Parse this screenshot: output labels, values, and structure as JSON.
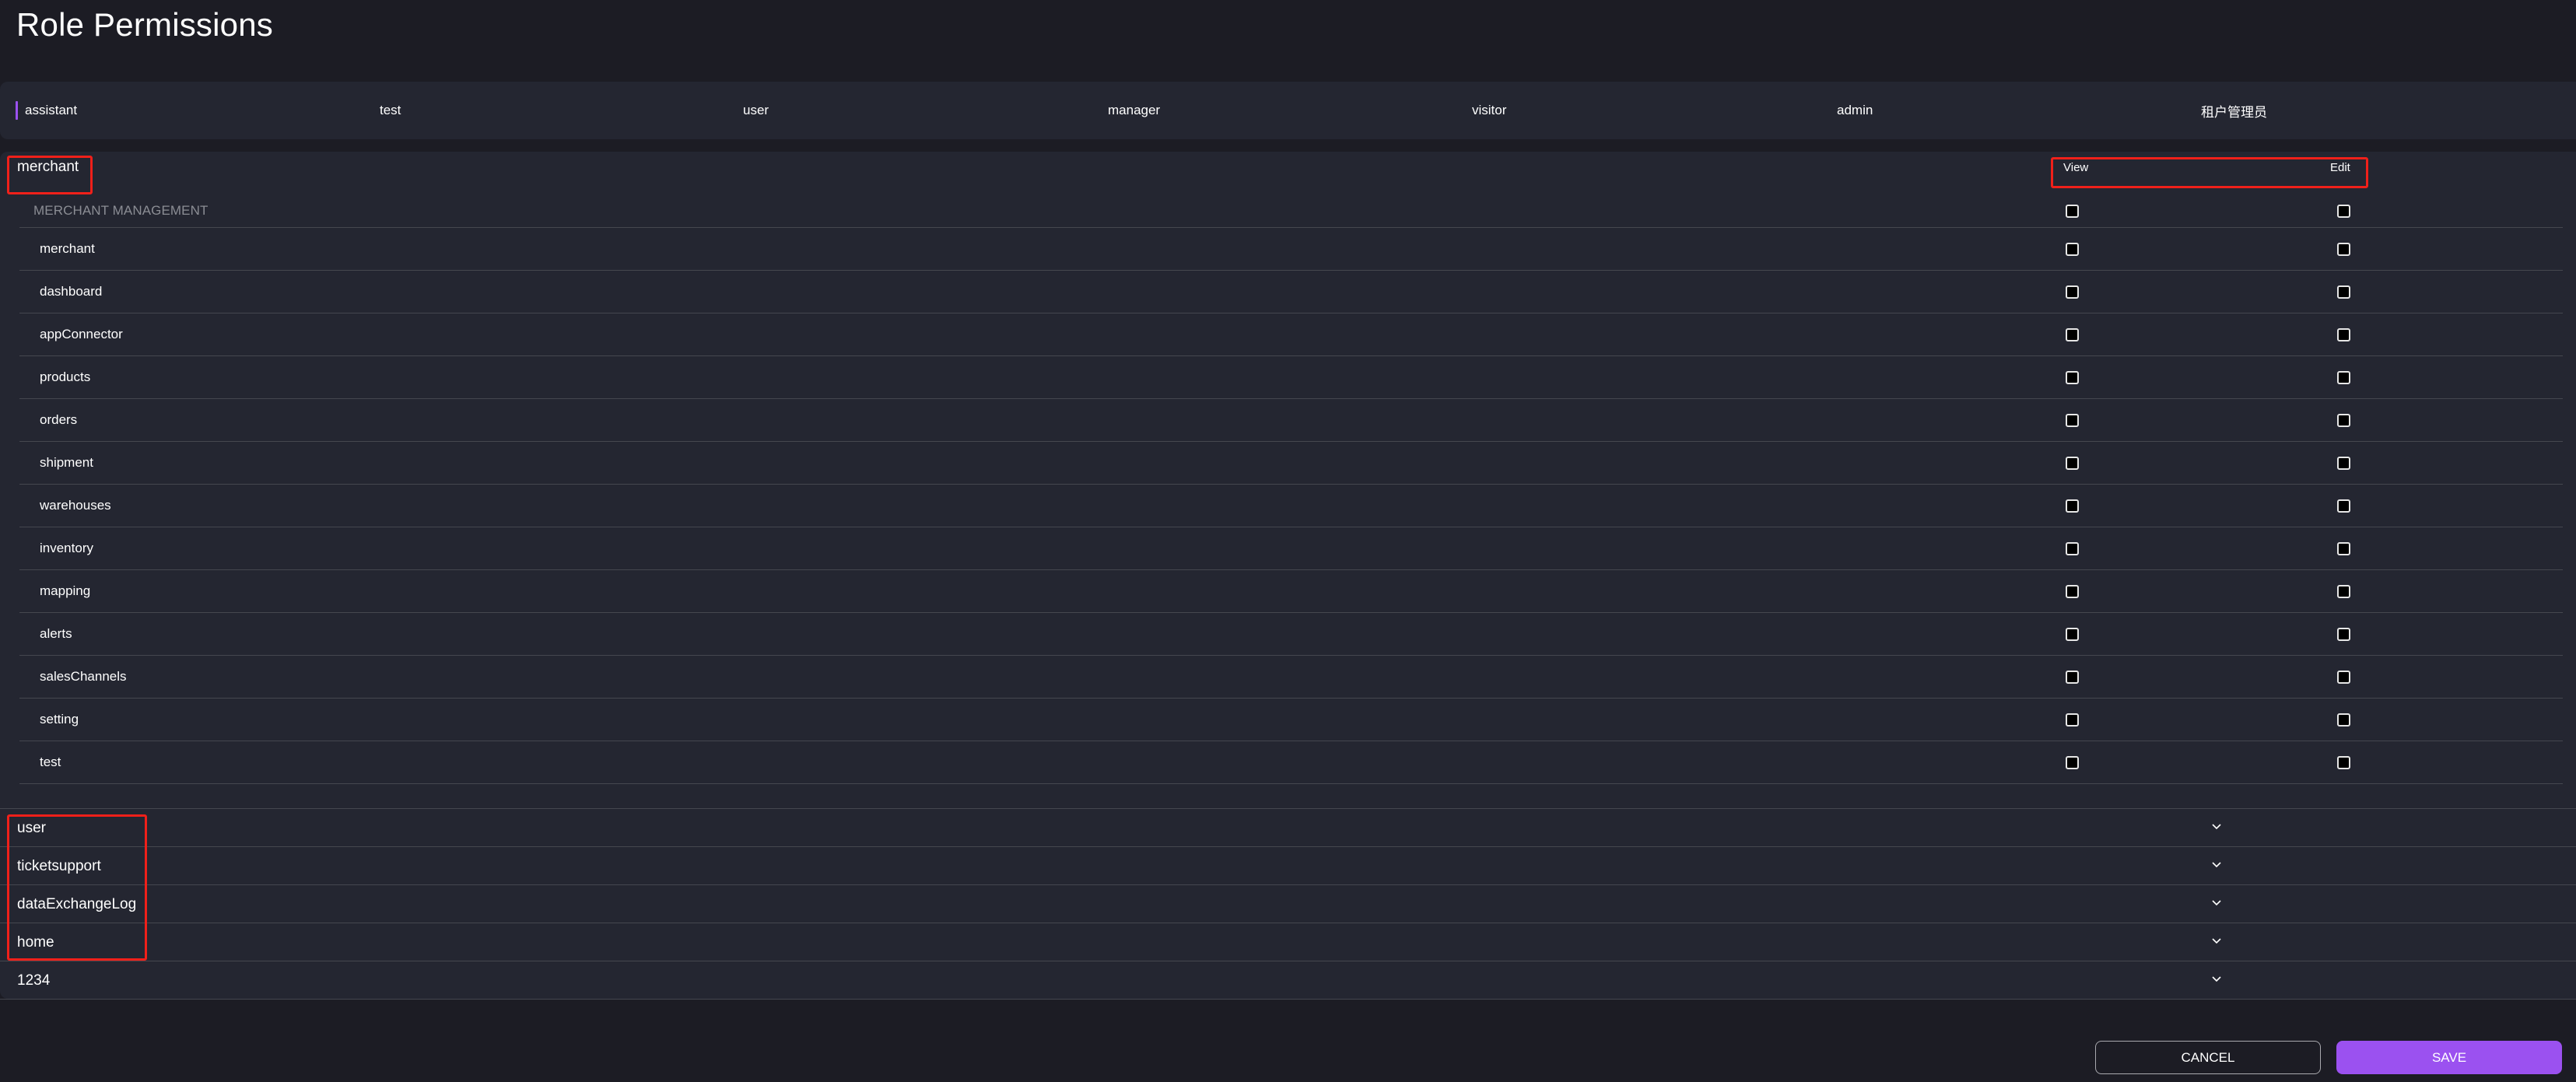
{
  "page": {
    "title": "Role Permissions"
  },
  "roles": {
    "active_index": 0,
    "accent_color": "#9b51f0",
    "items": [
      {
        "label": "assistant"
      },
      {
        "label": "test"
      },
      {
        "label": "user"
      },
      {
        "label": "manager"
      },
      {
        "label": "visitor"
      },
      {
        "label": "admin"
      },
      {
        "label": "租户管理员"
      }
    ]
  },
  "permissions": {
    "expanded_section": {
      "label": "merchant",
      "columns": {
        "view": "View",
        "edit": "Edit"
      },
      "group_label": "MERCHANT MANAGEMENT",
      "group_view_checked": false,
      "group_edit_checked": false,
      "items": [
        {
          "label": "merchant",
          "view": false,
          "edit": false
        },
        {
          "label": "dashboard",
          "view": false,
          "edit": false
        },
        {
          "label": "appConnector",
          "view": false,
          "edit": false
        },
        {
          "label": "products",
          "view": false,
          "edit": false
        },
        {
          "label": "orders",
          "view": false,
          "edit": false
        },
        {
          "label": "shipment",
          "view": false,
          "edit": false
        },
        {
          "label": "warehouses",
          "view": false,
          "edit": false
        },
        {
          "label": "inventory",
          "view": false,
          "edit": false
        },
        {
          "label": "mapping",
          "view": false,
          "edit": false
        },
        {
          "label": "alerts",
          "view": false,
          "edit": false
        },
        {
          "label": "salesChannels",
          "view": false,
          "edit": false
        },
        {
          "label": "setting",
          "view": false,
          "edit": false
        },
        {
          "label": "test",
          "view": false,
          "edit": false
        }
      ]
    },
    "collapsed_sections": [
      {
        "label": "user",
        "icon": "chevron-down-icon"
      },
      {
        "label": "ticketsupport",
        "icon": "chevron-down-icon"
      },
      {
        "label": "dataExchangeLog",
        "icon": "chevron-down-icon"
      },
      {
        "label": "home",
        "icon": "chevron-down-icon"
      },
      {
        "label": "1234",
        "icon": "chevron-down-icon"
      }
    ]
  },
  "annotations": {
    "color": "#f0201a"
  },
  "actions": {
    "cancel_label": "CANCEL",
    "save_label": "SAVE",
    "save_color": "#9b51f0"
  }
}
